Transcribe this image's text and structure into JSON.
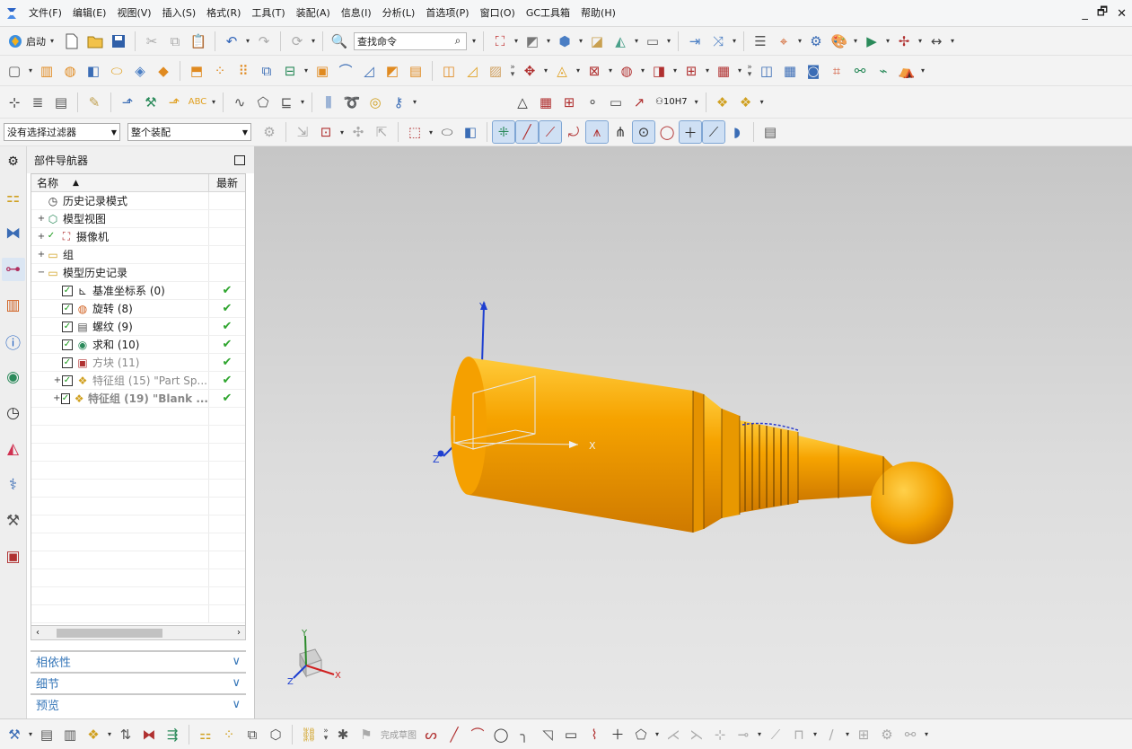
{
  "menubar": {
    "items": [
      "文件(F)",
      "编辑(E)",
      "视图(V)",
      "插入(S)",
      "格式(R)",
      "工具(T)",
      "装配(A)",
      "信息(I)",
      "分析(L)",
      "首选项(P)",
      "窗口(O)",
      "GC工具箱",
      "帮助(H)"
    ],
    "window_controls": [
      "_",
      "🗗",
      "✕"
    ]
  },
  "toolbar1": {
    "start_label": "启动",
    "find_placeholder": "查找命令"
  },
  "selection_bar": {
    "filter_value": "没有选择过滤器",
    "scope_value": "整个装配"
  },
  "navigator": {
    "title": "部件导航器",
    "columns": {
      "name": "名称",
      "latest": "最新"
    },
    "rows": [
      {
        "label": "历史记录模式",
        "level": 0,
        "expand": "",
        "checked": null,
        "latest": "",
        "style": "normal"
      },
      {
        "label": "模型视图",
        "level": 0,
        "expand": "+",
        "checked": null,
        "latest": "",
        "style": "normal"
      },
      {
        "label": "摄像机",
        "level": 0,
        "expand": "+",
        "checked": true,
        "latest": "",
        "style": "normal"
      },
      {
        "label": "组",
        "level": 0,
        "expand": "+",
        "checked": null,
        "latest": "",
        "style": "normal"
      },
      {
        "label": "模型历史记录",
        "level": 0,
        "expand": "−",
        "checked": null,
        "latest": "",
        "style": "normal"
      },
      {
        "label": "基准坐标系 (0)",
        "level": 1,
        "expand": "",
        "checked": true,
        "latest": "✔",
        "style": "normal"
      },
      {
        "label": "旋转 (8)",
        "level": 1,
        "expand": "",
        "checked": true,
        "latest": "✔",
        "style": "normal"
      },
      {
        "label": "螺纹 (9)",
        "level": 1,
        "expand": "",
        "checked": true,
        "latest": "✔",
        "style": "normal"
      },
      {
        "label": "求和 (10)",
        "level": 1,
        "expand": "",
        "checked": true,
        "latest": "✔",
        "style": "normal"
      },
      {
        "label": "方块 (11)",
        "level": 1,
        "expand": "",
        "checked": true,
        "latest": "✔",
        "style": "dim"
      },
      {
        "label": "特征组 (15) \"Part Sp...",
        "level": 1,
        "expand": "+",
        "checked": true,
        "latest": "✔",
        "style": "dim"
      },
      {
        "label": "特征组 (19) \"Blank ...",
        "level": 1,
        "expand": "+",
        "checked": true,
        "latest": "✔",
        "style": "bolddim"
      }
    ],
    "sections": [
      "相依性",
      "细节",
      "预览"
    ]
  },
  "viewport": {
    "triad_labels": {
      "x": "X",
      "y": "Y",
      "z": "Z"
    },
    "part_color": "#f5a800"
  },
  "bottombar": {
    "sketch_label": "完成草图"
  },
  "colors": {
    "accent": "#3576b8",
    "check_green": "#2ea52e",
    "part_orange": "#f5a800"
  }
}
